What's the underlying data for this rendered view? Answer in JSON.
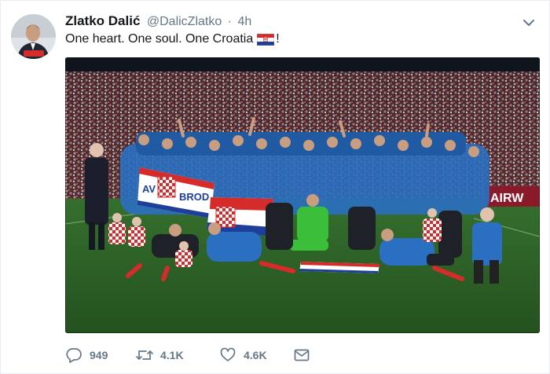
{
  "tweet": {
    "author_name": "Zlatko Dalić",
    "author_handle": "@DalicZlatko",
    "separator": "·",
    "timestamp": "4h",
    "text": "One heart. One soul. One Croatia",
    "text_suffix": "!",
    "flag_icon": "croatia-flag-emoji"
  },
  "photo": {
    "description_icon": "team-celebration-photo",
    "banner_text": "AIRW"
  },
  "actions": {
    "reply_count": "949",
    "retweet_count": "4.1K",
    "like_count": "4.6K"
  },
  "colors": {
    "text": "#14171a",
    "secondary": "#657786",
    "border": "#e6ecf0",
    "pitch": "#2f6b2a",
    "jersey_blue": "#2a6fc1",
    "croatia_red": "#d52b2b"
  }
}
